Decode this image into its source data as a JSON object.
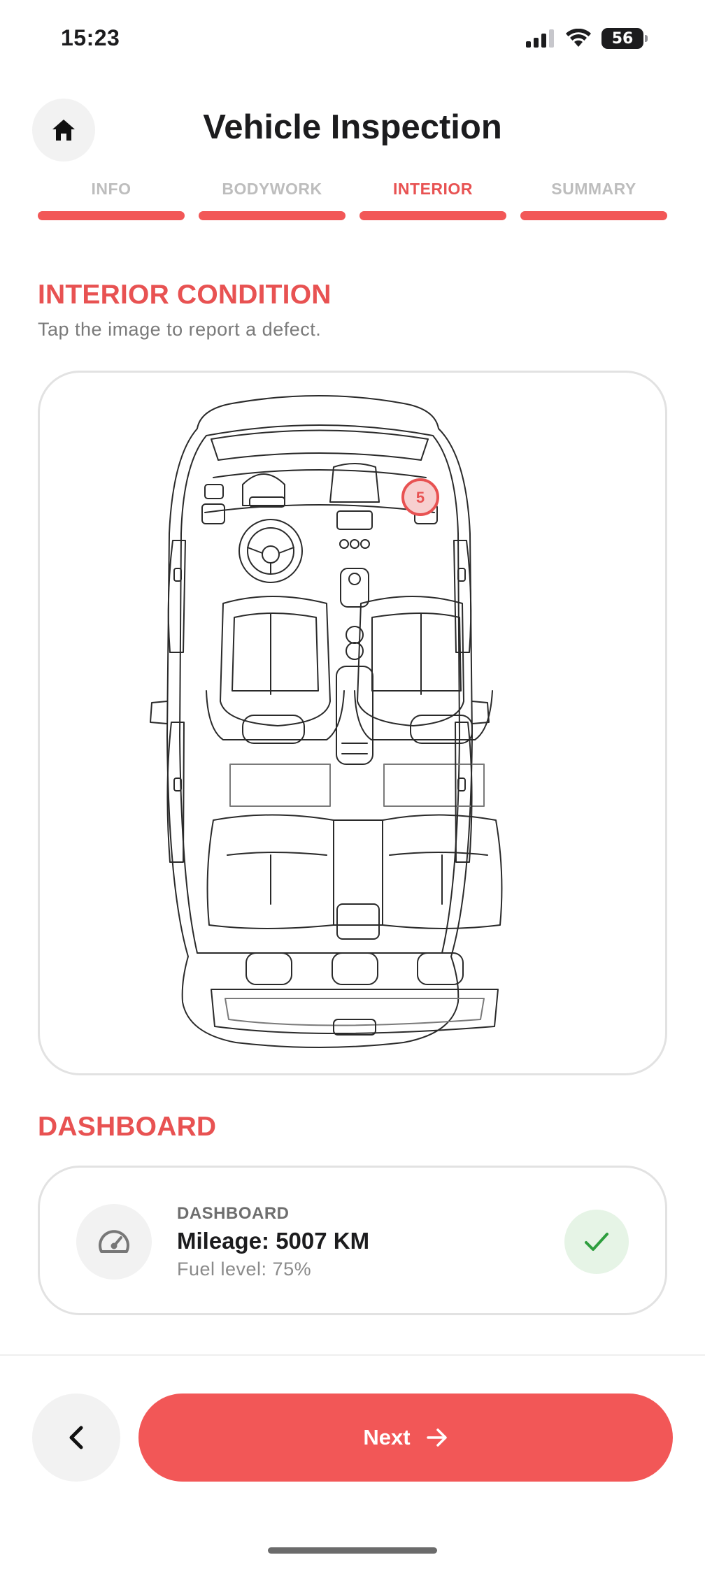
{
  "status_bar": {
    "time": "15:23",
    "battery": "56",
    "icons": [
      "signal-icon",
      "wifi-icon",
      "battery-icon"
    ]
  },
  "header": {
    "title": "Vehicle Inspection",
    "home_icon": "home-icon"
  },
  "steps": [
    {
      "label": "INFO",
      "active": false
    },
    {
      "label": "BODYWORK",
      "active": false
    },
    {
      "label": "INTERIOR",
      "active": true
    },
    {
      "label": "SUMMARY",
      "active": false
    }
  ],
  "interior": {
    "title": "INTERIOR CONDITION",
    "subtitle": "Tap the image to report a defect.",
    "defect_marker": "5"
  },
  "dashboard": {
    "title": "DASHBOARD",
    "card_label": "DASHBOARD",
    "mileage": "Mileage: 5007 KM",
    "fuel": "Fuel level: 75%",
    "icon": "speedometer-icon",
    "status_icon": "check-icon"
  },
  "footer": {
    "next_label": "Next",
    "back_icon": "chevron-left-icon",
    "next_icon": "arrow-right-icon"
  },
  "colors": {
    "accent": "#f25757",
    "accent_text": "#e85252",
    "success_bg": "#e6f4e6",
    "success": "#2e9e3e",
    "inactive": "#bdbdbd"
  }
}
